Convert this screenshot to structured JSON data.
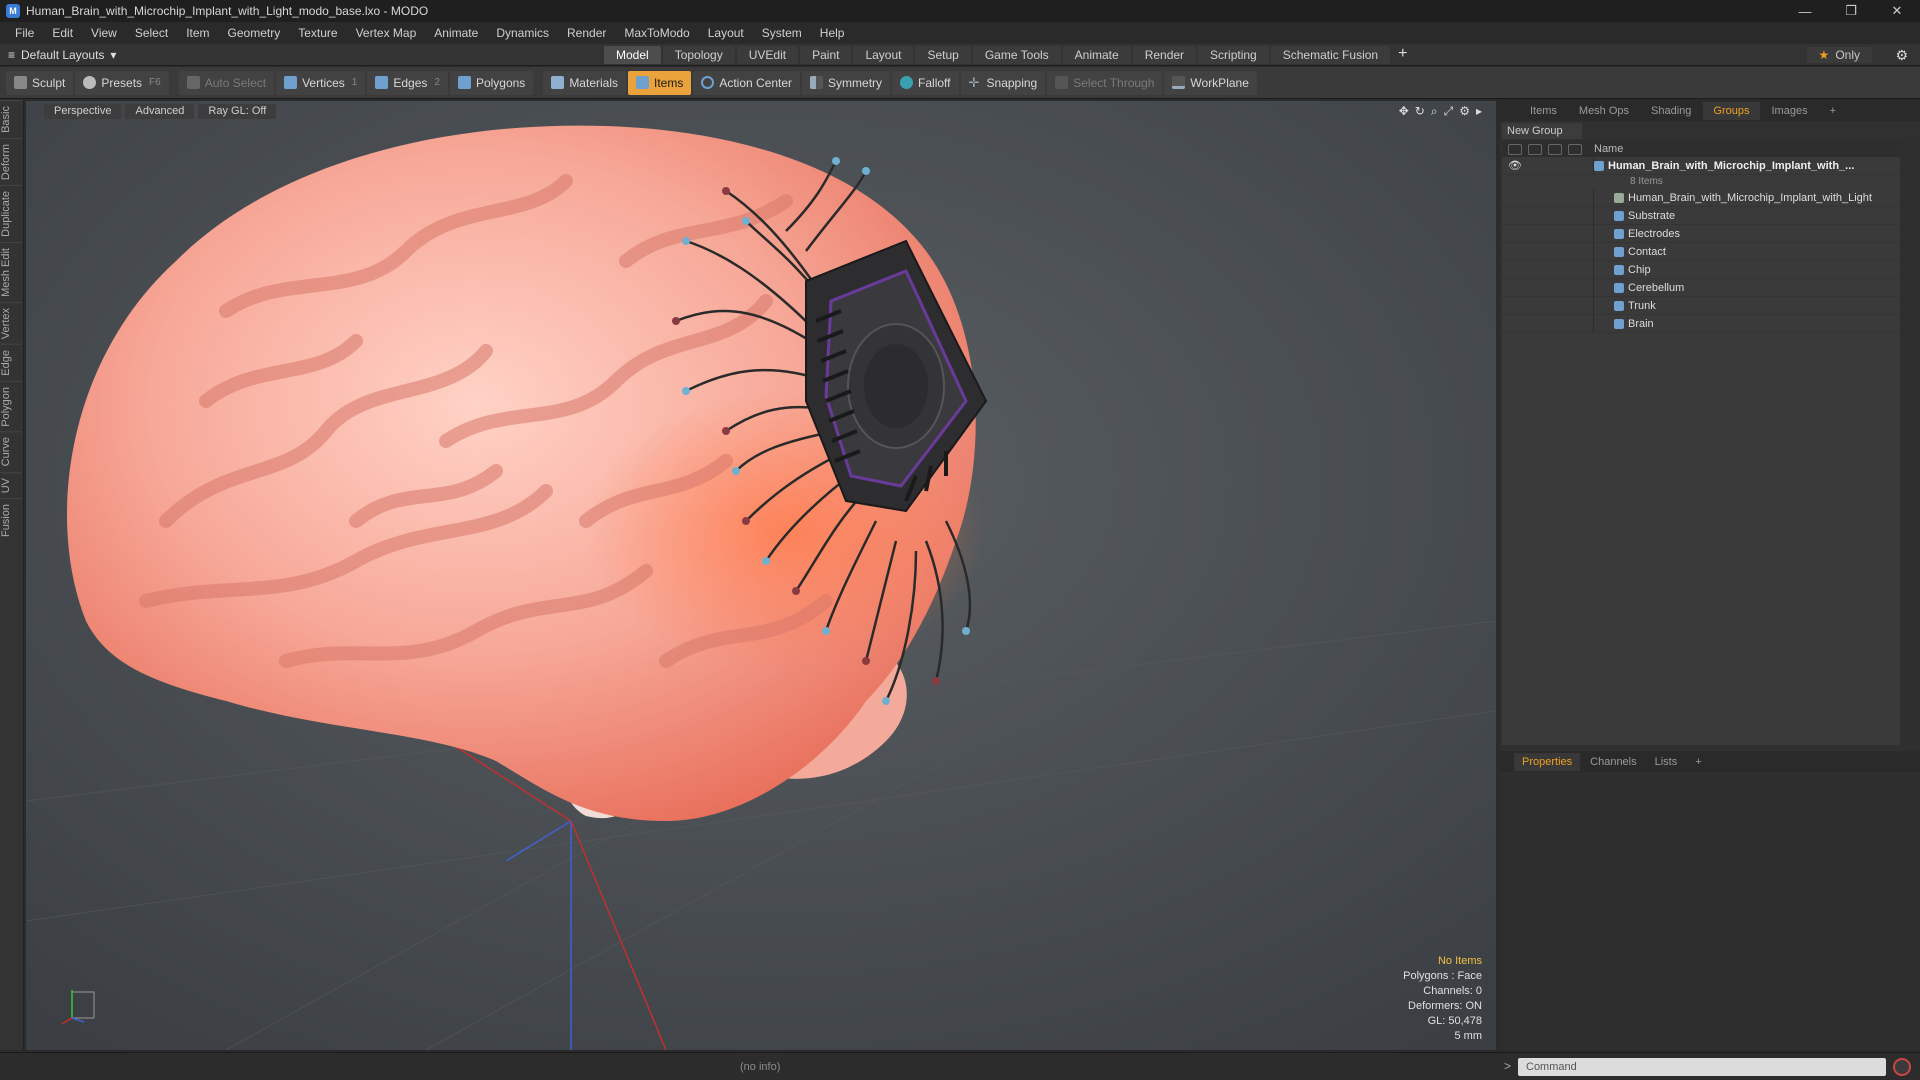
{
  "window": {
    "title": "Human_Brain_with_Microchip_Implant_with_Light_modo_base.lxo - MODO",
    "controls": [
      "—",
      "❐",
      "✕"
    ]
  },
  "menu": [
    "File",
    "Edit",
    "View",
    "Select",
    "Item",
    "Geometry",
    "Texture",
    "Vertex Map",
    "Animate",
    "Dynamics",
    "Render",
    "MaxToModo",
    "Layout",
    "System",
    "Help"
  ],
  "layout": {
    "selector": "Default Layouts",
    "tabs": [
      "Model",
      "Topology",
      "UVEdit",
      "Paint",
      "Layout",
      "Setup",
      "Game Tools",
      "Animate",
      "Render",
      "Scripting",
      "Schematic Fusion"
    ],
    "active_tab": "Model",
    "only_label": "Only"
  },
  "toolbar": {
    "sculpt": "Sculpt",
    "presets": "Presets",
    "presets_key": "F6",
    "auto_select": "Auto Select",
    "vertices": "Vertices",
    "vertices_key": "1",
    "edges": "Edges",
    "edges_key": "2",
    "polygons": "Polygons",
    "materials": "Materials",
    "items": "Items",
    "action_center": "Action Center",
    "symmetry": "Symmetry",
    "falloff": "Falloff",
    "snapping": "Snapping",
    "select_through": "Select Through",
    "workplane": "WorkPlane"
  },
  "left_strip": [
    "Basic",
    "Deform",
    "Duplicate",
    "Mesh Edit",
    "Vertex",
    "Edge",
    "Polygon",
    "Curve",
    "UV",
    "Fusion"
  ],
  "viewport": {
    "view_mode": "Perspective",
    "shading": "Advanced",
    "raygl": "Ray GL: Off",
    "info": {
      "items": "No Items",
      "polygons": "Polygons : Face",
      "channels": "Channels: 0",
      "deformers": "Deformers: ON",
      "gl": "GL: 50,478",
      "unit": "5 mm"
    }
  },
  "right_panel": {
    "tabs": [
      "Items",
      "Mesh Ops",
      "Shading",
      "Groups",
      "Images"
    ],
    "active_tab": "Groups",
    "new_group": "New Group",
    "name_header": "Name",
    "group_name": "Human_Brain_with_Microchip_Implant_with_...",
    "group_count": "8 Items",
    "items": [
      "Human_Brain_with_Microchip_Implant_with_Light",
      "Substrate",
      "Electrodes",
      "Contact",
      "Chip",
      "Cerebellum",
      "Trunk",
      "Brain"
    ]
  },
  "properties_panel": {
    "tabs": [
      "Properties",
      "Channels",
      "Lists"
    ],
    "active_tab": "Properties"
  },
  "status": {
    "info": "(no info)",
    "command_placeholder": "Command"
  },
  "colors": {
    "accent": "#e9a33a",
    "viewport_bg": "#4a4e52",
    "brain": "#f2a295"
  }
}
